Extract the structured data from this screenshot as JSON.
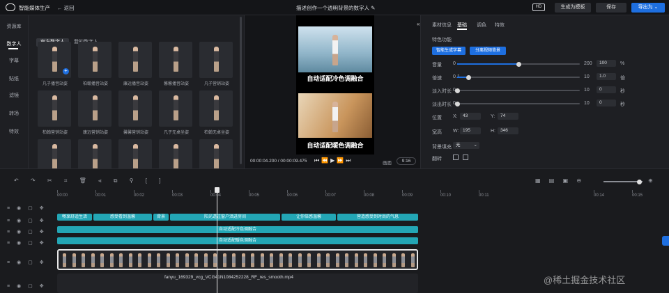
{
  "topbar": {
    "app_title": "智能媒体生产",
    "back_label": "返回",
    "doc_title": "描述创作一个透明背景的数字人",
    "hd_badge": "HD",
    "save_template": "生成为模板",
    "save": "保存",
    "export": "导出为"
  },
  "left": {
    "side_tabs": [
      "资源库",
      "数字人",
      "字幕",
      "贴纸",
      "滤镜",
      "转场",
      "特效"
    ],
    "sub_tabs": [
      "官方数字人",
      "我的数字人"
    ],
    "avatars": [
      "凡子播音站姿",
      "柏翰播音站姿",
      "康远播音站姿",
      "馨馨播音站姿",
      "凡子营销站姿",
      "柏翰营销站姿",
      "康远营销站姿",
      "馨馨营销站姿",
      "凡子无桌坐姿",
      "柏翰无桌坐姿",
      "",
      "",
      "",
      "",
      ""
    ]
  },
  "preview": {
    "caption1": "自动适配冷色调融合",
    "caption2": "自动适配暖色调融合",
    "time_current": "00:00:04.200",
    "time_total": "00:00:09.475",
    "ratio_label": "画面",
    "aspect": "9:16"
  },
  "right": {
    "tabs": [
      "素材信息",
      "基础",
      "调色",
      "特效"
    ],
    "section": "特色功能",
    "btn_subtitle": "智能生成字幕",
    "btn_bg": "分离视频背景",
    "rows": [
      {
        "label": "音量",
        "min": "0",
        "max": "200",
        "value": "100",
        "unit": "%",
        "level": 0.5
      },
      {
        "label": "倍速",
        "min": "0.1",
        "max": "10",
        "value": "1.0",
        "unit": "倍",
        "level": 0.09
      },
      {
        "label": "淡入时长",
        "min": "0",
        "max": "10",
        "value": "0",
        "unit": "秒",
        "level": 0
      },
      {
        "label": "淡出时长",
        "min": "0",
        "max": "10",
        "value": "0",
        "unit": "秒",
        "level": 0
      }
    ],
    "pos_label": "位置",
    "x_label": "X:",
    "x_value": "43",
    "y_label": "Y:",
    "y_value": "74",
    "size_label": "宽高",
    "w_label": "W:",
    "w_value": "195",
    "h_label": "H:",
    "h_value": "346",
    "bg_fill_label": "背景填充",
    "bg_fill_value": "无",
    "flip_label": "翻转"
  },
  "timeline": {
    "ticks": [
      "00:00",
      "00:01",
      "00:02",
      "00:03",
      "00:04",
      "00:05",
      "00:06",
      "00:07",
      "00:08",
      "00:09",
      "00:10",
      "00:11",
      "00:14",
      "00:15"
    ],
    "row1_clips": [
      "畅享舒适生活",
      "感受看到温馨",
      "背景",
      "阳光透过窗户洒进房间",
      "让你倍感温馨",
      "营造感受到时尚的气息"
    ],
    "row2_clip": "自动适配冷色调融合",
    "row3_clip": "自动适配暖色调融合",
    "filename": "fanyu_169329_vcg_VCG41N1084252228_RF_res_smooth.mp4"
  },
  "watermark": "@稀土掘金技术社区",
  "colors": {
    "accent": "#1e6fe0",
    "clip": "#23a6b5",
    "bg": "#1b1c1f"
  }
}
